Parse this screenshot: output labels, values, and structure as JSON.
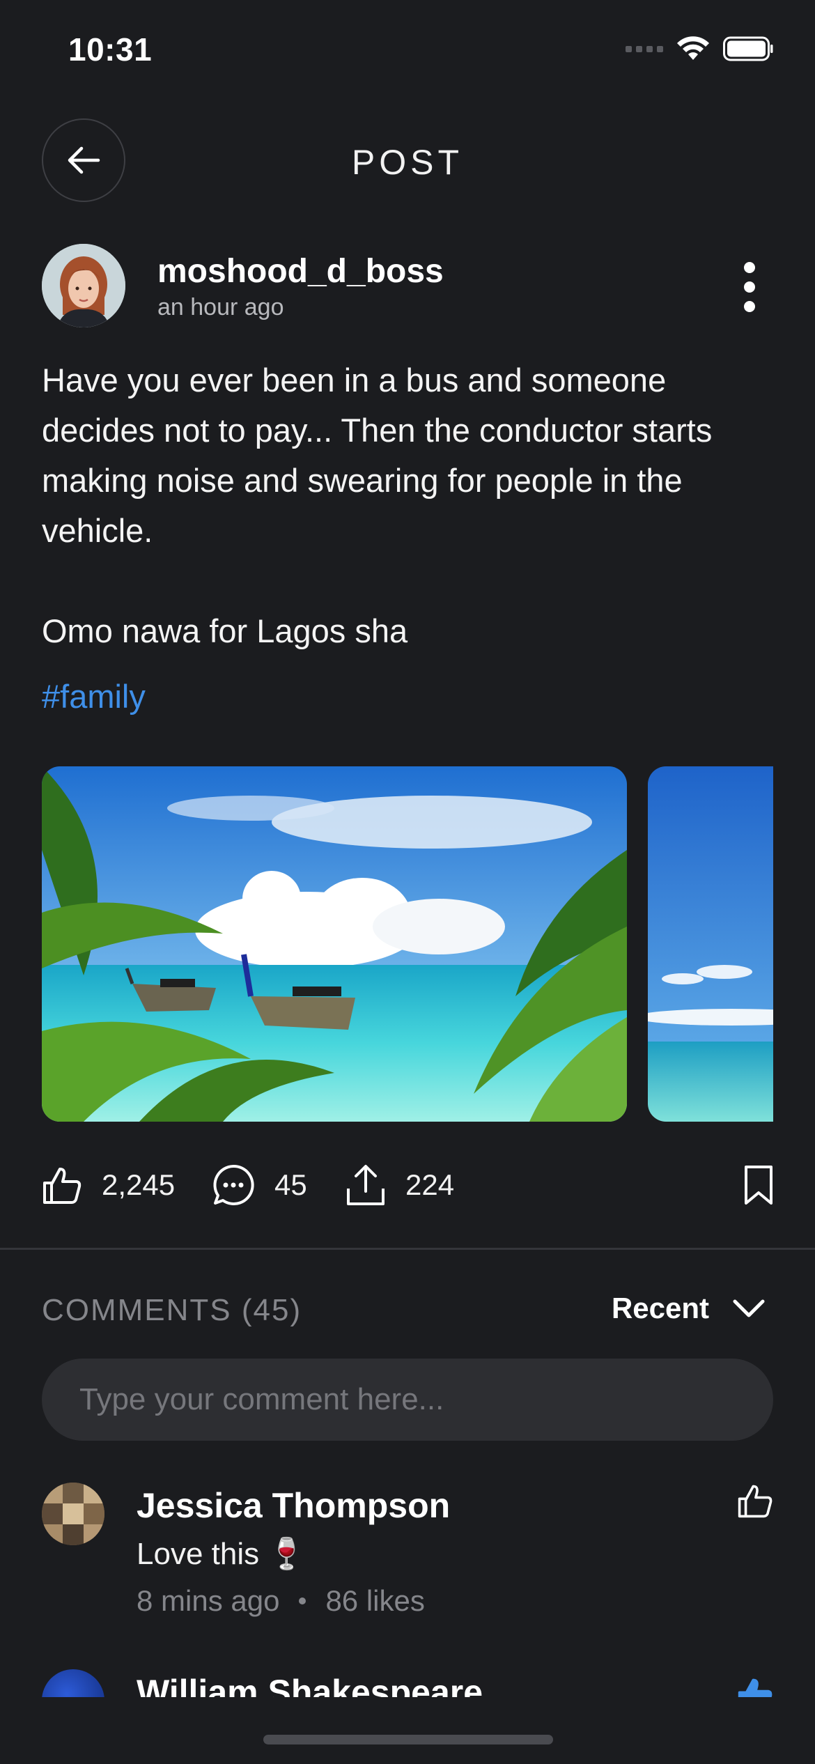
{
  "status_bar": {
    "time": "10:31"
  },
  "header": {
    "title": "POST"
  },
  "author": {
    "username": "moshood_d_boss",
    "posted": "an hour ago"
  },
  "post": {
    "paragraphs": [
      "Have you ever been in a bus and someone decides not to pay... Then the conductor starts making noise and swearing for people in the vehicle.",
      "Omo nawa for Lagos sha"
    ],
    "hashtag": "#family"
  },
  "gallery": {
    "images": [
      "tropical-beach-boats",
      "tropical-beach-sky"
    ]
  },
  "actions": {
    "likes": "2,245",
    "comments": "45",
    "shares": "224"
  },
  "comments": {
    "title": "COMMENTS (45)",
    "sort_label": "Recent",
    "input_placeholder": "Type your comment here...",
    "items": [
      {
        "name": "Jessica Thompson",
        "text": "Love this 🍷",
        "time": "8 mins ago",
        "likes": "86 likes"
      },
      {
        "name": "William Shakespeare"
      }
    ]
  },
  "colors": {
    "background": "#1b1c1f",
    "hashtag": "#3f8fe8",
    "liked": "#3f8fe8",
    "muted": "#85868b"
  }
}
